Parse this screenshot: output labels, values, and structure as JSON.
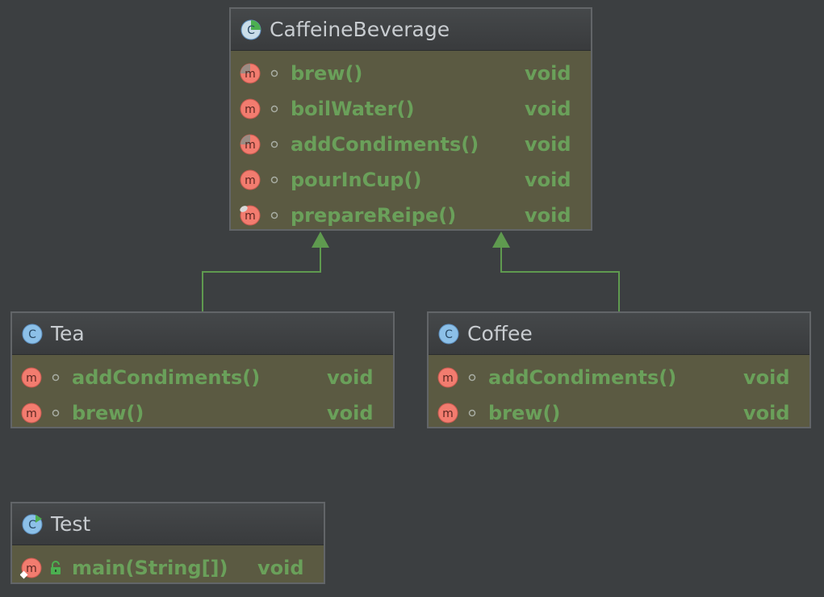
{
  "classes": [
    {
      "id": "caffeine",
      "name": "CaffeineBeverage",
      "kind": "abstract-class",
      "methods": [
        {
          "name": "brew()",
          "type": "void",
          "icon": "abstract-method-icon",
          "vis": "package-private"
        },
        {
          "name": "boilWater()",
          "type": "void",
          "icon": "method-icon",
          "vis": "package-private"
        },
        {
          "name": "addCondiments()",
          "type": "void",
          "icon": "abstract-method-icon",
          "vis": "package-private"
        },
        {
          "name": "pourInCup()",
          "type": "void",
          "icon": "method-icon",
          "vis": "package-private"
        },
        {
          "name": "prepareReipe()",
          "type": "void",
          "icon": "final-method-icon",
          "vis": "package-private"
        }
      ]
    },
    {
      "id": "tea",
      "name": "Tea",
      "kind": "class",
      "methods": [
        {
          "name": "addCondiments()",
          "type": "void",
          "icon": "method-icon",
          "vis": "package-private"
        },
        {
          "name": "brew()",
          "type": "void",
          "icon": "method-icon",
          "vis": "package-private"
        }
      ]
    },
    {
      "id": "coffee",
      "name": "Coffee",
      "kind": "class",
      "methods": [
        {
          "name": "addCondiments()",
          "type": "void",
          "icon": "method-icon",
          "vis": "package-private"
        },
        {
          "name": "brew()",
          "type": "void",
          "icon": "method-icon",
          "vis": "package-private"
        }
      ]
    },
    {
      "id": "test",
      "name": "Test",
      "kind": "runnable-class",
      "methods": [
        {
          "name": "main(String[])",
          "type": "void",
          "icon": "static-method-icon",
          "vis": "public"
        }
      ]
    }
  ],
  "relations": [
    {
      "from": "Tea",
      "to": "CaffeineBeverage",
      "type": "inheritance"
    },
    {
      "from": "Coffee",
      "to": "CaffeineBeverage",
      "type": "inheritance"
    }
  ],
  "colors": {
    "background": "#3c3f41",
    "body": "#5b5a42",
    "text_green": "#6aa05a",
    "arrow": "#5f9a4f",
    "method_icon": "#f27c6f",
    "class_icon": "#8cc0e8"
  }
}
